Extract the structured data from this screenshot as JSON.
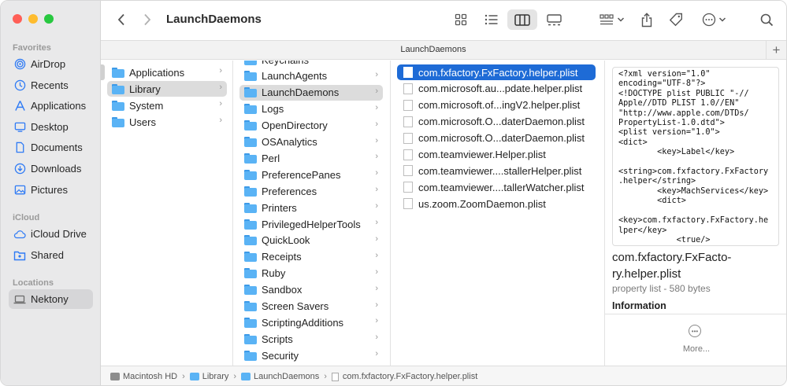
{
  "window": {
    "title": "LaunchDaemons",
    "tab_title": "LaunchDaemons"
  },
  "sidebar": {
    "sections": [
      {
        "label": "Favorites",
        "items": [
          {
            "label": "AirDrop",
            "icon": "airdrop-icon"
          },
          {
            "label": "Recents",
            "icon": "clock-icon"
          },
          {
            "label": "Applications",
            "icon": "applications-icon"
          },
          {
            "label": "Desktop",
            "icon": "desktop-icon"
          },
          {
            "label": "Documents",
            "icon": "document-icon"
          },
          {
            "label": "Downloads",
            "icon": "download-icon"
          },
          {
            "label": "Pictures",
            "icon": "pictures-icon"
          }
        ]
      },
      {
        "label": "iCloud",
        "items": [
          {
            "label": "iCloud Drive",
            "icon": "cloud-icon"
          },
          {
            "label": "Shared",
            "icon": "shared-folder-icon"
          }
        ]
      },
      {
        "label": "Locations",
        "items": [
          {
            "label": "Nektony",
            "icon": "laptop-icon",
            "selected": true
          }
        ]
      }
    ]
  },
  "columns": {
    "col1": [
      {
        "label": "Applications"
      },
      {
        "label": "Library",
        "selected": true
      },
      {
        "label": "System"
      },
      {
        "label": "Users"
      }
    ],
    "col2": [
      {
        "label": "Keychains"
      },
      {
        "label": "LaunchAgents"
      },
      {
        "label": "LaunchDaemons",
        "selected": true
      },
      {
        "label": "Logs"
      },
      {
        "label": "OpenDirectory"
      },
      {
        "label": "OSAnalytics"
      },
      {
        "label": "Perl"
      },
      {
        "label": "PreferencePanes"
      },
      {
        "label": "Preferences"
      },
      {
        "label": "Printers"
      },
      {
        "label": "PrivilegedHelperTools"
      },
      {
        "label": "QuickLook"
      },
      {
        "label": "Receipts"
      },
      {
        "label": "Ruby"
      },
      {
        "label": "Sandbox"
      },
      {
        "label": "Screen Savers"
      },
      {
        "label": "ScriptingAdditions"
      },
      {
        "label": "Scripts"
      },
      {
        "label": "Security"
      }
    ],
    "col3": [
      {
        "label": "com.fxfactory.FxFactory.helper.plist",
        "selected": true
      },
      {
        "label": "com.microsoft.au...pdate.helper.plist"
      },
      {
        "label": "com.microsoft.of...ingV2.helper.plist"
      },
      {
        "label": "com.microsoft.O...daterDaemon.plist"
      },
      {
        "label": "com.microsoft.O...daterDaemon.plist"
      },
      {
        "label": "com.teamviewer.Helper.plist"
      },
      {
        "label": "com.teamviewer....stallerHelper.plist"
      },
      {
        "label": "com.teamviewer....tallerWatcher.plist"
      },
      {
        "label": "us.zoom.ZoomDaemon.plist"
      }
    ]
  },
  "preview": {
    "code": "<?xml version=\"1.0\"\nencoding=\"UTF-8\"?>\n<!DOCTYPE plist PUBLIC \"-//\nApple//DTD PLIST 1.0//EN\"\n\"http://www.apple.com/DTDs/\nPropertyList-1.0.dtd\">\n<plist version=\"1.0\">\n<dict>\n        <key>Label</key>\n\n<string>com.fxfactory.FxFactory\n.helper</string>\n        <key>MachServices</key>\n        <dict>\n\n<key>com.fxfactory.FxFactory.he\nlper</key>\n            <true/>\n        </dict>",
    "name_line1": "com.fxfactory.FxFacto-",
    "name_line2": "ry.helper.plist",
    "meta": "property list - 580 bytes",
    "info_label": "Information",
    "more_label": "More..."
  },
  "pathbar": {
    "segments": [
      "Macintosh HD",
      "Library",
      "LaunchDaemons",
      "com.fxfactory.FxFactory.helper.plist"
    ]
  },
  "colors": {
    "selection_blue": "#1e6bd6",
    "folder_blue": "#5ab3f5",
    "sidebar_icon_blue": "#2f7bf5",
    "close": "#ff5f57",
    "minimize": "#febc2e",
    "zoom": "#28c840"
  }
}
